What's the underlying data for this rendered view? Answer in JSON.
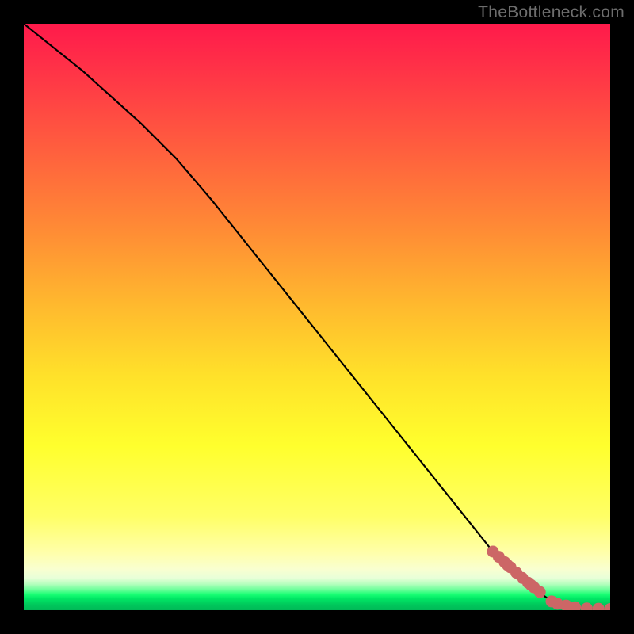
{
  "watermark": "TheBottleneck.com",
  "colors": {
    "line": "#000000",
    "marker": "#cc6666",
    "background_black": "#000000"
  },
  "chart_data": {
    "type": "line",
    "title": "",
    "xlabel": "",
    "ylabel": "",
    "xlim": [
      0,
      100
    ],
    "ylim": [
      0,
      100
    ],
    "series": [
      {
        "name": "curve",
        "x": [
          0,
          10,
          20,
          26,
          32,
          40,
          50,
          60,
          70,
          80,
          86,
          90,
          92,
          94,
          96,
          98,
          100
        ],
        "y": [
          100,
          92,
          83,
          77,
          70,
          60,
          47.5,
          35,
          22.5,
          10,
          4.5,
          1.5,
          0.8,
          0.5,
          0.3,
          0.25,
          0.2
        ]
      }
    ],
    "markers": {
      "name": "points",
      "x": [
        80,
        81,
        82,
        82.5,
        83,
        84,
        85,
        86,
        86.5,
        87,
        88,
        90,
        91,
        92.5,
        94,
        96,
        98,
        100
      ],
      "y": [
        10,
        9.1,
        8.2,
        7.7,
        7.3,
        6.4,
        5.5,
        4.7,
        4.3,
        3.9,
        3.1,
        1.5,
        1.1,
        0.8,
        0.5,
        0.3,
        0.25,
        0.2
      ]
    }
  }
}
